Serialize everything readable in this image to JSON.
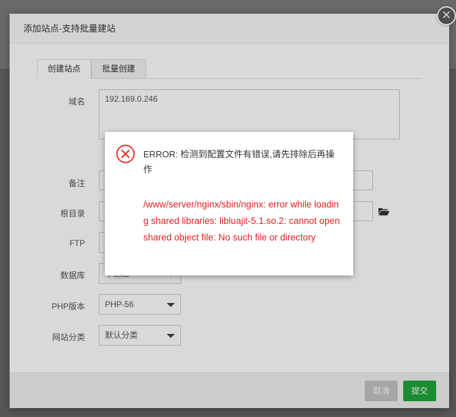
{
  "dialog": {
    "title": "添加站点-支持批量建站",
    "close_label": "×",
    "tabs": [
      {
        "label": "创建站点"
      },
      {
        "label": "批量创建"
      }
    ],
    "fields": {
      "domain_label": "域名",
      "domain_value": "192.169.0.246",
      "remark_label": "备注",
      "root_label": "根目录",
      "ftp_label": "FTP",
      "database_label": "数据库",
      "database_value": "不创建",
      "php_label": "PHP版本",
      "php_value": "PHP-56",
      "category_label": "网站分类",
      "category_value": "默认分类"
    },
    "buttons": {
      "cancel_label": "取消",
      "submit_label": "提交"
    }
  },
  "error": {
    "title": "ERROR: 检测到配置文件有错误,请先排除后再操作",
    "detail": "/www/server/nginx/sbin/nginx: error while loading shared libraries: libluajit-5.1.so.2: cannot open shared object file: No such file or directory"
  },
  "colors": {
    "accent_green": "#20a53a",
    "error_red": "#e02020"
  }
}
